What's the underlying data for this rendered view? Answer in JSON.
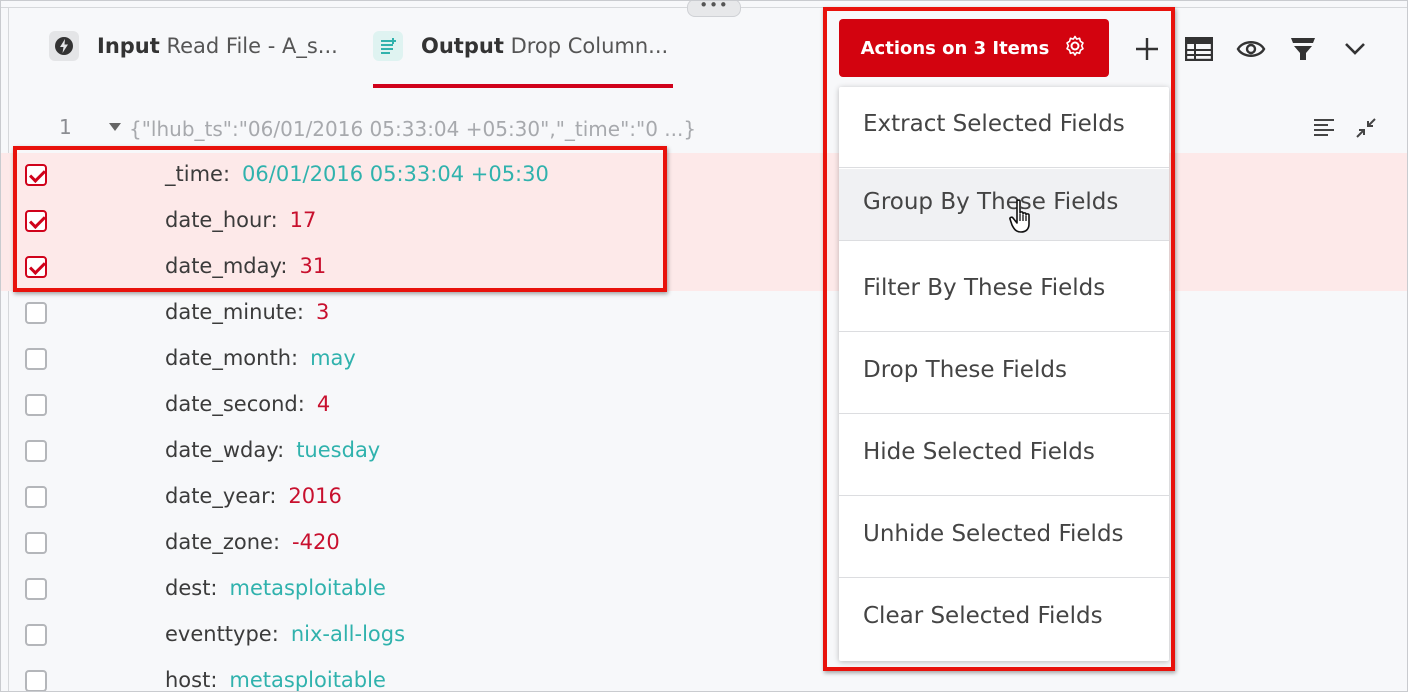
{
  "tabs": [
    {
      "label_bold": "Input",
      "label_rest": "Read File - A_s...",
      "icon": "bolt-icon",
      "active": false
    },
    {
      "label_bold": "Output",
      "label_rest": "Drop Column...",
      "icon": "document-icon",
      "active": true
    }
  ],
  "toolbar": {
    "actions_label": "Actions on 3 Items",
    "actions_icon": "gear-icon",
    "icons": [
      "plus-icon",
      "table-icon",
      "eye-icon",
      "filter-icon",
      "chevron-down-icon"
    ]
  },
  "json_line": {
    "line_number": "1",
    "preview": "{\"lhub_ts\":\"06/01/2016 05:33:04 +05:30\",\"_time\":\"0 ...}"
  },
  "fields": [
    {
      "key": "_time:",
      "value": "06/01/2016 05:33:04 +05:30",
      "type": "str",
      "checked": true
    },
    {
      "key": "date_hour:",
      "value": "17",
      "type": "num",
      "checked": true
    },
    {
      "key": "date_mday:",
      "value": "31",
      "type": "num",
      "checked": true
    },
    {
      "key": "date_minute:",
      "value": "3",
      "type": "num",
      "checked": false
    },
    {
      "key": "date_month:",
      "value": "may",
      "type": "str",
      "checked": false
    },
    {
      "key": "date_second:",
      "value": "4",
      "type": "num",
      "checked": false
    },
    {
      "key": "date_wday:",
      "value": "tuesday",
      "type": "str",
      "checked": false
    },
    {
      "key": "date_year:",
      "value": "2016",
      "type": "num",
      "checked": false
    },
    {
      "key": "date_zone:",
      "value": "-420",
      "type": "num",
      "checked": false
    },
    {
      "key": "dest:",
      "value": "metasploitable",
      "type": "str",
      "checked": false
    },
    {
      "key": "eventtype:",
      "value": "nix-all-logs",
      "type": "str",
      "checked": false
    },
    {
      "key": "host:",
      "value": "metasploitable",
      "type": "str",
      "checked": false
    }
  ],
  "menu": {
    "items": [
      "Extract Selected Fields",
      "Group By These Fields",
      "Filter By These Fields",
      "Drop These Fields",
      "Hide Selected Fields",
      "Unhide Selected Fields",
      "Clear Selected Fields"
    ],
    "hovered_index": 1
  },
  "colors": {
    "accent_red": "#d3030f",
    "number_value": "#c8102e",
    "string_value": "#30b2ad",
    "annotation": "#e8120c"
  }
}
